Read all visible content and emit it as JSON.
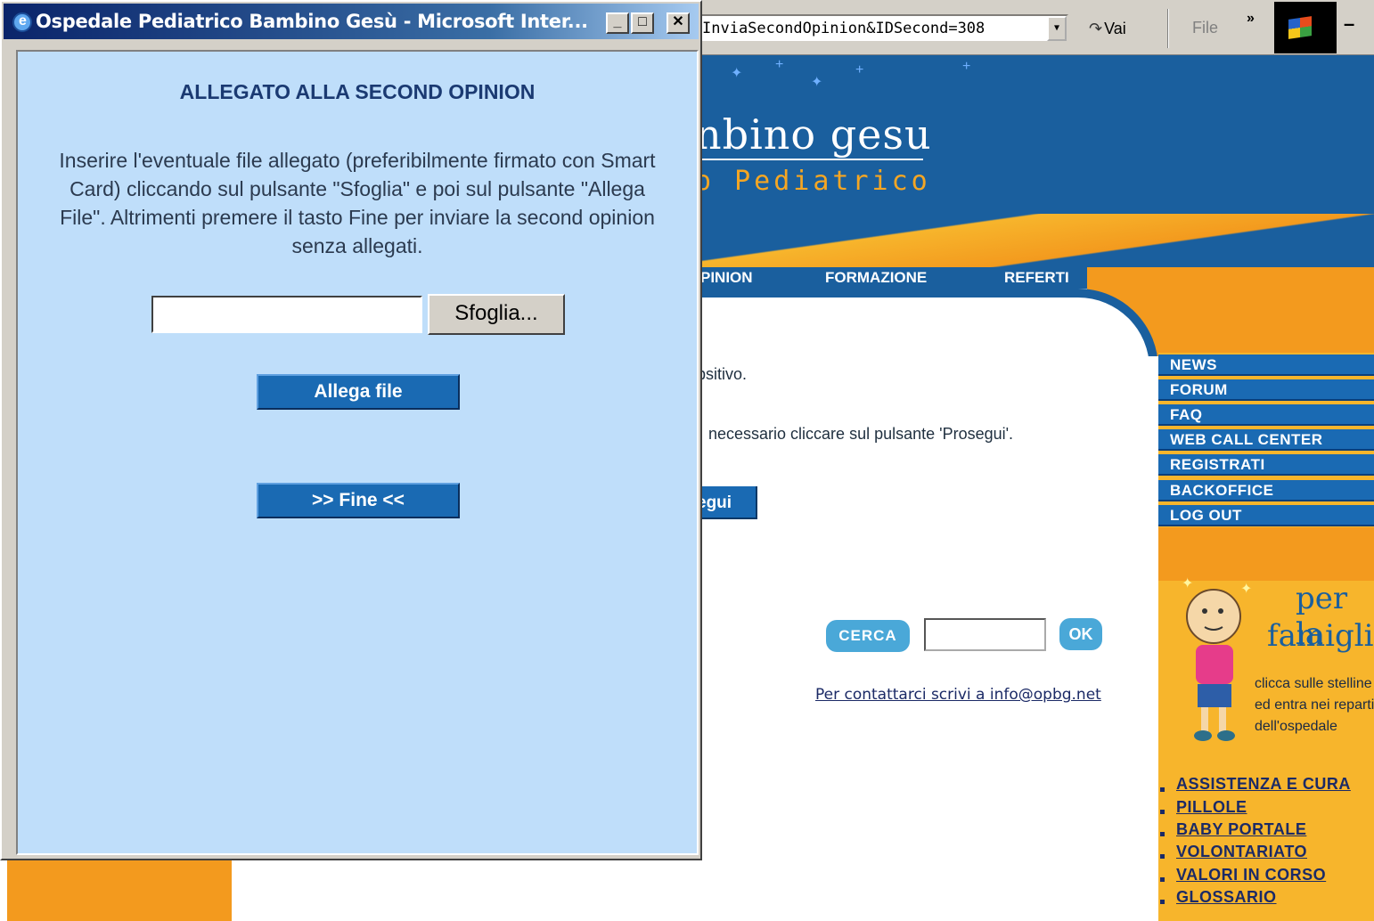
{
  "popup": {
    "title": "Ospedale Pediatrico Bambino Gesù - Microsoft Inter...",
    "heading": "ALLEGATO ALLA SECOND OPINION",
    "description": "Inserire l'eventuale file allegato (preferibilmente firmato con Smart Card) cliccando sul pulsante \"Sfoglia\" e poi sul pulsante \"Allega File\". Altrimenti premere il tasto Fine per inviare la second opinion senza allegati.",
    "file_input_value": "",
    "browse_label": "Sfoglia...",
    "attach_label": "Allega file",
    "finish_label": ">> Fine <<",
    "window_buttons": {
      "minimize": "_",
      "maximize": "□",
      "close": "✕"
    }
  },
  "browser": {
    "address": "InviaSecondOpinion&IDSecond=308",
    "go_label": "Vai",
    "file_menu": "File",
    "more_label": "»"
  },
  "site": {
    "logo_text": "nbino gesu",
    "logo_subtitle": "o Pediatrico",
    "nav": [
      "PINION",
      "FORMAZIONE",
      "REFERTI"
    ],
    "side_nav": [
      "NEWS",
      "FORUM",
      "FAQ",
      "WEB CALL CENTER",
      "REGISTRATI",
      "BACKOFFICE",
      "LOG OUT"
    ],
    "content_line1": "psitivo.",
    "content_line2": "necessario cliccare sul pulsante 'Prosegui'.",
    "prosegui_label": "egui",
    "search_label": "CERCA",
    "search_value": "",
    "ok_label": "OK",
    "contact": "Per contattarci scrivi a info@opbg.net",
    "famiglia_line1": "per la",
    "famiglia_line2": "famiglia",
    "famiglia_text": "clicca sulle stelline ed entra nei reparti dell'ospedale",
    "family_links": [
      "ASSISTENZA E CURA",
      "PILLOLE",
      "BABY PORTALE",
      "VOLONTARIATO",
      "VALORI IN CORSO",
      "GLOSSARIO"
    ]
  },
  "colors": {
    "primary_blue": "#1a5f9e",
    "button_blue": "#1a6ab3",
    "orange": "#f39a1e",
    "popup_bg": "#bfdefa"
  }
}
